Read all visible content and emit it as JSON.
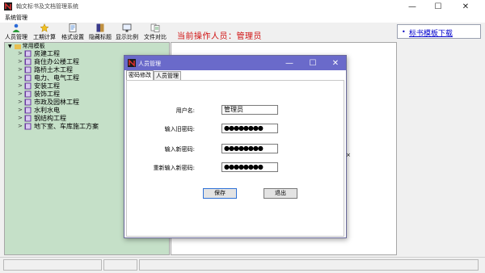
{
  "window": {
    "title": "翰文标书及文档管理系统",
    "controls": {
      "minimize": "—",
      "maximize": "☐",
      "close": "✕"
    }
  },
  "menu": {
    "items": [
      "系统管理"
    ]
  },
  "toolbar": {
    "items": [
      {
        "label": "人员管理",
        "icon": "user-manage-icon"
      },
      {
        "label": "工期计算",
        "icon": "schedule-calc-icon"
      },
      {
        "label": "格式设置",
        "icon": "format-settings-icon"
      },
      {
        "label": "隐藏标题",
        "icon": "hide-title-icon"
      },
      {
        "label": "显示比例",
        "icon": "zoom-ratio-icon"
      },
      {
        "label": "文件对比",
        "icon": "file-compare-icon"
      }
    ],
    "current_operator": "当前操作人员：管理员"
  },
  "link_panel": {
    "bullet": "•",
    "link": "标书模板下载"
  },
  "tree": {
    "root": "常用模板",
    "items": [
      "房建工程",
      "商住办公楼工程",
      "路桥土木工程",
      "电力、电气工程",
      "安装工程",
      "装饰工程",
      "市政及园林工程",
      "水利水电",
      "钢结构工程",
      "地下室、车库施工方案"
    ]
  },
  "mdi_close_glyph": "×",
  "dialog": {
    "title": "人员管理",
    "controls": {
      "minimize": "—",
      "maximize": "☐",
      "close": "✕"
    },
    "tabs": [
      "密码修改",
      "人员管理"
    ],
    "active_tab": "密码修改",
    "fields": {
      "username": {
        "label": "用户名:",
        "value": "管理员"
      },
      "old_password": {
        "label": "输入旧密码:",
        "value": "●●●●●●●●"
      },
      "new_password": {
        "label": "输入新密码:",
        "value": "●●●●●●●●"
      },
      "confirm_password": {
        "label": "重新输入新密码:",
        "value": "●●●●●●●●"
      }
    },
    "buttons": {
      "save": "保存",
      "exit": "退出"
    }
  },
  "colors": {
    "tree_bg": "#c5e0c8",
    "dialog_title_bg": "#6a6aca",
    "operator_text": "#d01010",
    "link": "#0000cc"
  }
}
